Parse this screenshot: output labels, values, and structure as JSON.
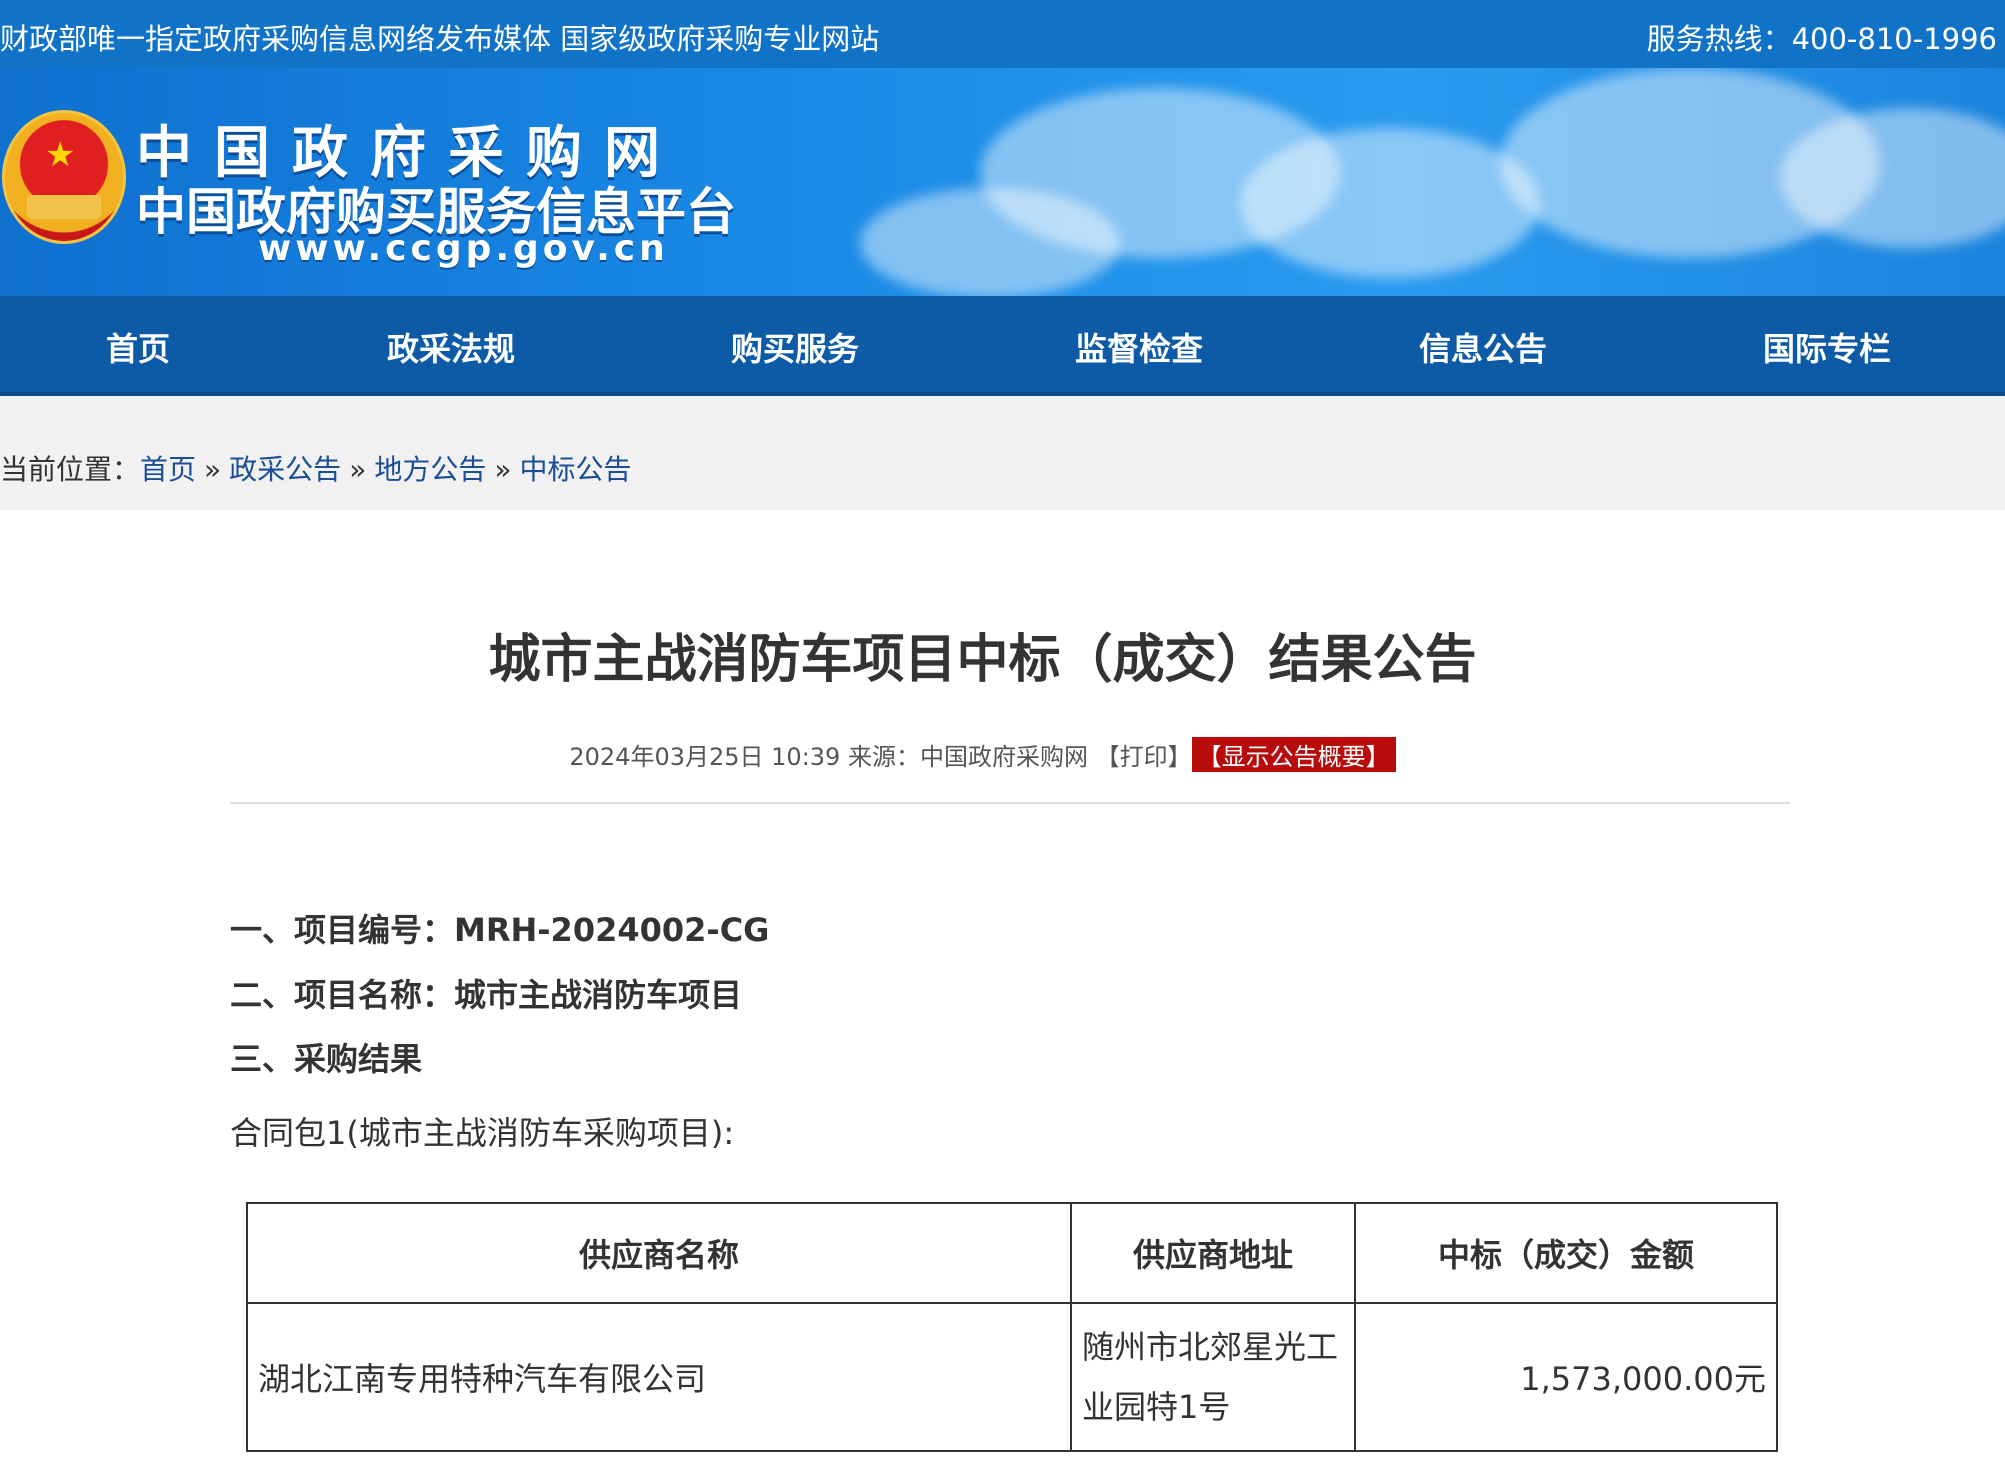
{
  "topbar": {
    "slogan": "财政部唯一指定政府采购信息网络发布媒体 国家级政府采购专业网站",
    "hotline": "服务热线：400-810-1996"
  },
  "banner": {
    "site_name": "中国政府采购网",
    "platform_name": "中国政府购买服务信息平台",
    "url": "www.ccgp.gov.cn"
  },
  "nav": {
    "items": [
      {
        "label": "首页"
      },
      {
        "label": "政采法规"
      },
      {
        "label": "购买服务"
      },
      {
        "label": "监督检查"
      },
      {
        "label": "信息公告"
      },
      {
        "label": "国际专栏"
      }
    ]
  },
  "breadcrumb": {
    "prefix": "当前位置：",
    "items": [
      "首页",
      "政采公告",
      "地方公告",
      "中标公告"
    ],
    "separator": "»"
  },
  "article": {
    "title": "城市主战消防车项目中标（成交）结果公告",
    "datetime": "2024年03月25日 10:39",
    "source_label": "来源：",
    "source": "中国政府采购网",
    "print_label": "【打印】",
    "summary_label": "【显示公告概要】",
    "section1": "一、项目编号：MRH-2024002-CG",
    "section2": "二、项目名称：城市主战消防车项目",
    "section3": "三、采购结果",
    "package": "合同包1(城市主战消防车采购项目):",
    "table": {
      "headers": [
        "供应商名称",
        "供应商地址",
        "中标（成交）金额"
      ],
      "rows": [
        {
          "name": "湖北江南专用特种汽车有限公司",
          "address": "随州市北郊星光工业园特1号",
          "amount": "1,573,000.00元"
        }
      ]
    }
  },
  "colors": {
    "topbar": "#1173c7",
    "nav": "#0d5ba6",
    "summary_badge": "#b80c0c",
    "link": "#1a4f95"
  }
}
